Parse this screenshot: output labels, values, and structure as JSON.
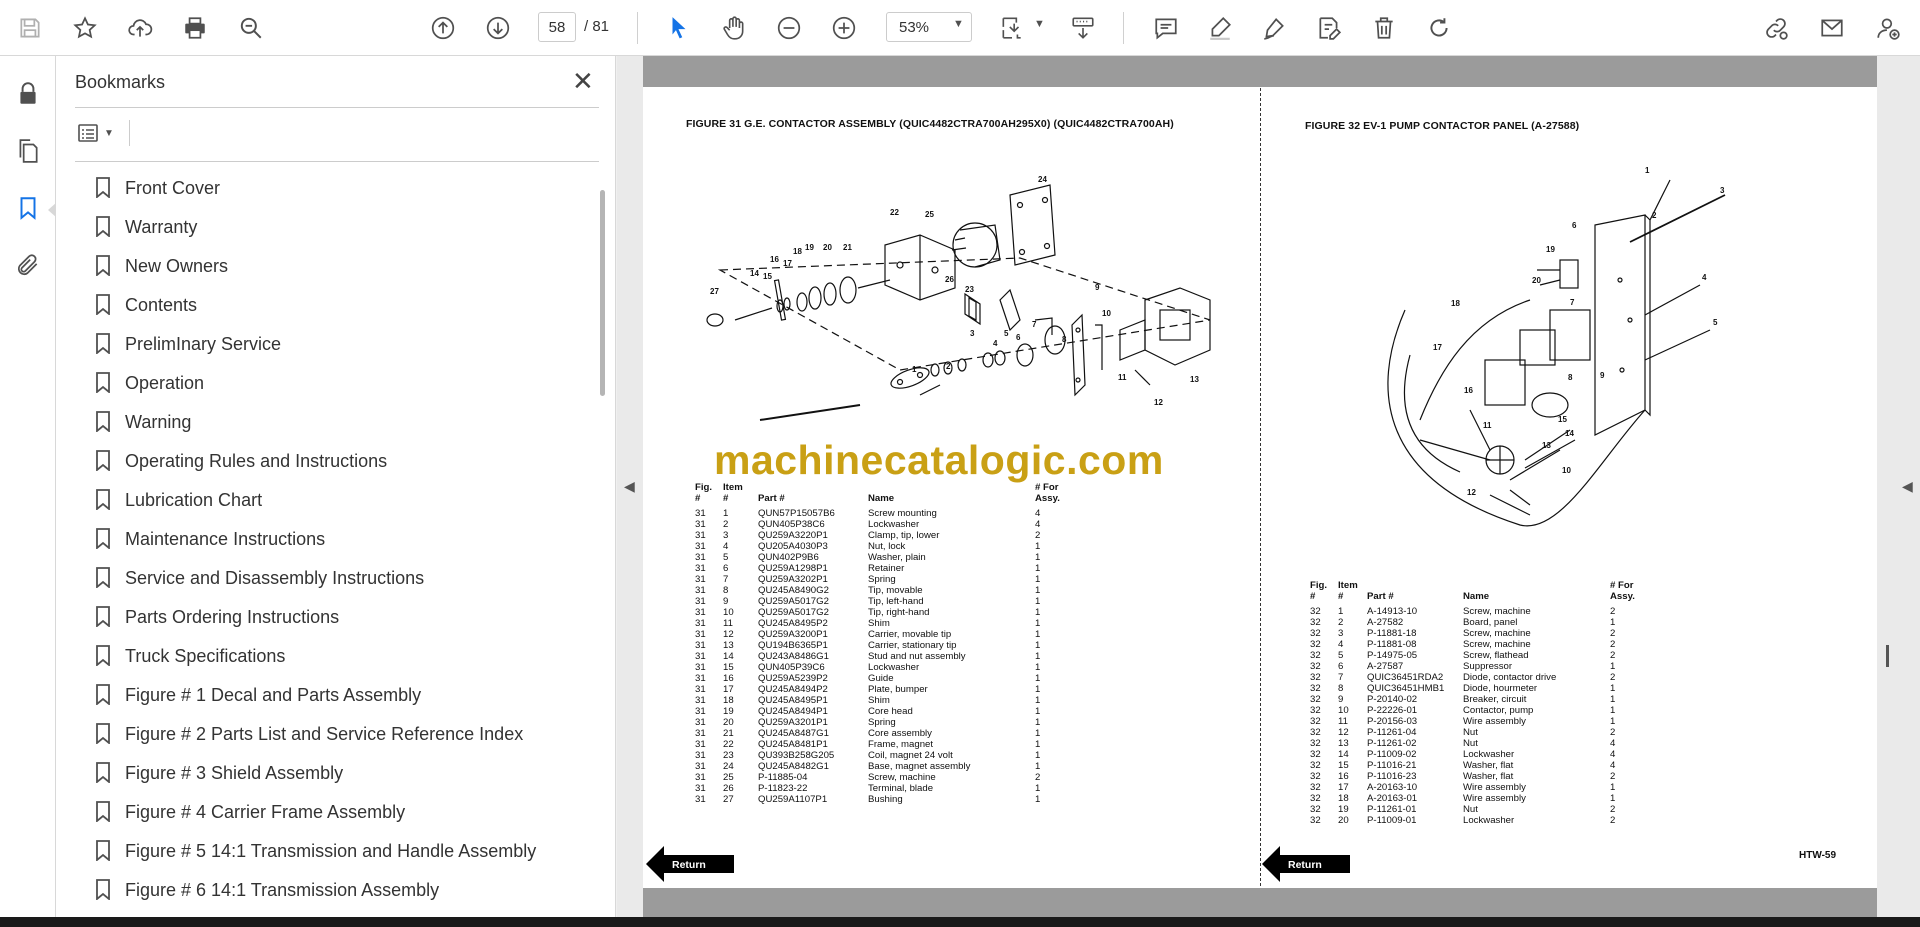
{
  "toolbar": {
    "current_page": "58",
    "total_pages": "/ 81",
    "zoom": "53%"
  },
  "bookmarks": {
    "title": "Bookmarks",
    "items": [
      {
        "label": "Front Cover"
      },
      {
        "label": "Warranty"
      },
      {
        "label": "New Owners"
      },
      {
        "label": "Contents"
      },
      {
        "label": "PrelimInary Service"
      },
      {
        "label": "Operation"
      },
      {
        "label": "Warning"
      },
      {
        "label": "Operating Rules and Instructions"
      },
      {
        "label": "Lubrication Chart"
      },
      {
        "label": "Maintenance Instructions"
      },
      {
        "label": "Service and Disassembly Instructions"
      },
      {
        "label": "Parts Ordering Instructions"
      },
      {
        "label": "Truck Specifications"
      },
      {
        "label": "Figure # 1 Decal and Parts Assembly"
      },
      {
        "label": "Figure # 2 Parts List and Service Reference Index"
      },
      {
        "label": "Figure # 3 Shield Assembly"
      },
      {
        "label": "Figure # 4 Carrier Frame Assembly"
      },
      {
        "label": "Figure # 5 14:1 Transmission and Handle Assembly"
      },
      {
        "label": "Figure # 6 14:1 Transmission Assembly"
      }
    ]
  },
  "document": {
    "left_title": "FIGURE 31 G.E. CONTACTOR ASSEMBLY (QUIC4482CTRA700AH295X0) (QUIC4482CTRA700AH)",
    "right_title": "FIGURE 32 EV-1 PUMP CONTACTOR PANEL (A-27588)",
    "watermark": "machinecatalogic.com",
    "return_label": "Return",
    "page_code": "HTW-59",
    "left_table": {
      "headers": {
        "fig": "Fig.\n#",
        "item": "Item\n#",
        "part": "Part #",
        "name": "Name",
        "qty": "# For\nAssy."
      },
      "rows": [
        [
          "31",
          "1",
          "QUN57P15057B6",
          "Screw mounting",
          "4"
        ],
        [
          "31",
          "2",
          "QUN405P38C6",
          "Lockwasher",
          "4"
        ],
        [
          "31",
          "3",
          "QU259A3220P1",
          "Clamp, tip, lower",
          "2"
        ],
        [
          "31",
          "4",
          "QU205A4030P3",
          "Nut, lock",
          "1"
        ],
        [
          "31",
          "5",
          "QUN402P9B6",
          "Washer, plain",
          "1"
        ],
        [
          "31",
          "6",
          "QU259A1298P1",
          "Retainer",
          "1"
        ],
        [
          "31",
          "7",
          "QU259A3202P1",
          "Spring",
          "1"
        ],
        [
          "31",
          "8",
          "QU245A8490G2",
          "Tip, movable",
          "1"
        ],
        [
          "31",
          "9",
          "QU259A5017G2",
          "Tip, left-hand",
          "1"
        ],
        [
          "31",
          "10",
          "QU259A5017G2",
          "Tip, right-hand",
          "1"
        ],
        [
          "31",
          "11",
          "QU245A8495P2",
          "Shim",
          "1"
        ],
        [
          "31",
          "12",
          "QU259A3200P1",
          "Carrier, movable tip",
          "1"
        ],
        [
          "31",
          "13",
          "QU194B6365P1",
          "Carrier, stationary tip",
          "1"
        ],
        [
          "31",
          "14",
          "QU243A8486G1",
          "Stud and nut assembly",
          "1"
        ],
        [
          "31",
          "15",
          "QUN405P39C6",
          "Lockwasher",
          "1"
        ],
        [
          "31",
          "16",
          "QU259A5239P2",
          "Guide",
          "1"
        ],
        [
          "31",
          "17",
          "QU245A8494P2",
          "Plate, bumper",
          "1"
        ],
        [
          "31",
          "18",
          "QU245A8495P1",
          "Shim",
          "1"
        ],
        [
          "31",
          "19",
          "QU245A8494P1",
          "Core head",
          "1"
        ],
        [
          "31",
          "20",
          "QU259A3201P1",
          "Spring",
          "1"
        ],
        [
          "31",
          "21",
          "QU245A8487G1",
          "Core assembly",
          "1"
        ],
        [
          "31",
          "22",
          "QU245A8481P1",
          "Frame, magnet",
          "1"
        ],
        [
          "31",
          "23",
          "QU393B258G205",
          "Coil, magnet 24 volt",
          "1"
        ],
        [
          "31",
          "24",
          "QU245A8482G1",
          "Base, magnet assembly",
          "1"
        ],
        [
          "31",
          "25",
          "P-11885-04",
          "Screw, machine",
          "2"
        ],
        [
          "31",
          "26",
          "P-11823-22",
          "Terminal, blade",
          "1"
        ],
        [
          "31",
          "27",
          "QU259A1107P1",
          "Bushing",
          "1"
        ]
      ]
    },
    "right_table": {
      "headers": {
        "fig": "Fig.\n#",
        "item": "Item\n#",
        "part": "Part #",
        "name": "Name",
        "qty": "# For\nAssy."
      },
      "rows": [
        [
          "32",
          "1",
          "A-14913-10",
          "Screw, machine",
          "2"
        ],
        [
          "32",
          "2",
          "A-27582",
          "Board, panel",
          "1"
        ],
        [
          "32",
          "3",
          "P-11881-18",
          "Screw, machine",
          "2"
        ],
        [
          "32",
          "4",
          "P-11881-08",
          "Screw, machine",
          "2"
        ],
        [
          "32",
          "5",
          "P-14975-05",
          "Screw, flathead",
          "2"
        ],
        [
          "32",
          "6",
          "A-27587",
          "Suppressor",
          "1"
        ],
        [
          "32",
          "7",
          "QUIC36451RDA2",
          "Diode, contactor drive",
          "2"
        ],
        [
          "32",
          "8",
          "QUIC36451HMB1",
          "Diode, hourmeter",
          "1"
        ],
        [
          "32",
          "9",
          "P-20140-02",
          "Breaker, circuit",
          "1"
        ],
        [
          "32",
          "10",
          "P-22226-01",
          "Contactor, pump",
          "1"
        ],
        [
          "32",
          "11",
          "P-20156-03",
          "Wire assembly",
          "1"
        ],
        [
          "32",
          "12",
          "P-11261-04",
          "Nut",
          "2"
        ],
        [
          "32",
          "13",
          "P-11261-02",
          "Nut",
          "4"
        ],
        [
          "32",
          "14",
          "P-11009-02",
          "Lockwasher",
          "4"
        ],
        [
          "32",
          "15",
          "P-11016-21",
          "Washer, flat",
          "4"
        ],
        [
          "32",
          "16",
          "P-11016-23",
          "Washer, flat",
          "2"
        ],
        [
          "32",
          "17",
          "A-20163-10",
          "Wire assembly",
          "1"
        ],
        [
          "32",
          "18",
          "A-20163-01",
          "Wire assembly",
          "1"
        ],
        [
          "32",
          "19",
          "P-11261-01",
          "Nut",
          "2"
        ],
        [
          "32",
          "20",
          "P-11009-01",
          "Lockwasher",
          "2"
        ]
      ]
    },
    "left_callouts": [
      "1",
      "2",
      "3",
      "4",
      "5",
      "6",
      "7",
      "8",
      "9",
      "10",
      "11",
      "12",
      "13",
      "14",
      "15",
      "16",
      "17",
      "18",
      "19",
      "20",
      "21",
      "22",
      "23",
      "24",
      "25",
      "26",
      "27"
    ],
    "right_callouts": [
      "1",
      "2",
      "3",
      "4",
      "5",
      "6",
      "7",
      "8",
      "9",
      "10",
      "11",
      "12",
      "13",
      "14",
      "15",
      "16",
      "17",
      "18",
      "19",
      "20"
    ]
  }
}
